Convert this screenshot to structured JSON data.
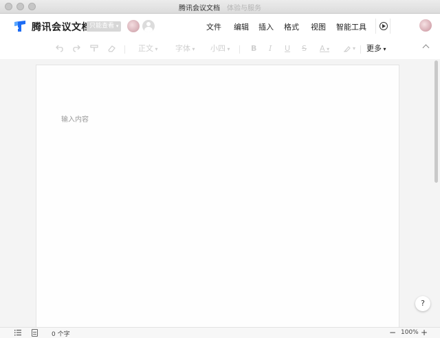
{
  "window": {
    "title": "腾讯会议文档",
    "subtitle": "体验与服务"
  },
  "header": {
    "app_name": "腾讯会议文档",
    "badge": "只能查看",
    "menu": [
      {
        "label": "文件"
      },
      {
        "label": "编辑"
      },
      {
        "label": "插入"
      },
      {
        "label": "格式"
      },
      {
        "label": "视图"
      },
      {
        "label": "智能工具"
      }
    ]
  },
  "toolbar": {
    "paragraph_style": "正文",
    "font": "字体",
    "font_size": "小四",
    "bold": "B",
    "italic": "I",
    "underline": "U",
    "strike": "S",
    "font_color": "A",
    "more": "更多",
    "icons": [
      "undo-icon",
      "redo-icon",
      "format-painter-icon",
      "eraser-icon",
      "highlighter-icon"
    ]
  },
  "editor": {
    "placeholder": "输入内容"
  },
  "help": {
    "label": "?"
  },
  "statusbar": {
    "word_count": "0 个字",
    "zoom_out": "−",
    "zoom": "100%",
    "zoom_in": "+"
  },
  "colors": {
    "accent": "#1d6cf4",
    "badge_bg": "#d7d7d7",
    "disabled": "#cfcfcf"
  }
}
